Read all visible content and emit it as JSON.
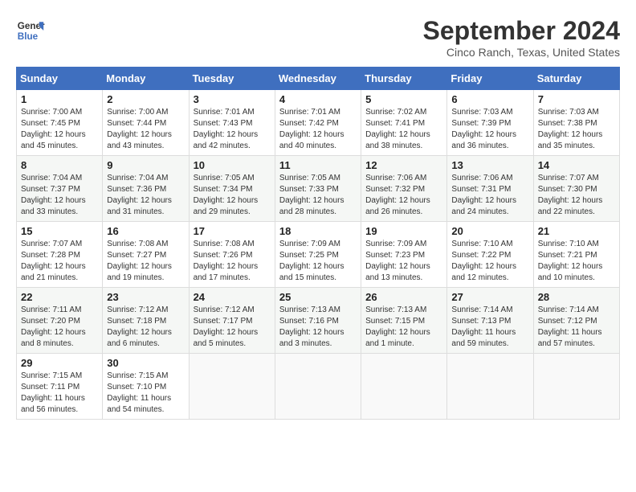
{
  "header": {
    "logo_line1": "General",
    "logo_line2": "Blue",
    "month_title": "September 2024",
    "location": "Cinco Ranch, Texas, United States"
  },
  "calendar": {
    "days_of_week": [
      "Sunday",
      "Monday",
      "Tuesday",
      "Wednesday",
      "Thursday",
      "Friday",
      "Saturday"
    ],
    "weeks": [
      [
        null,
        {
          "day": "2",
          "sunrise": "Sunrise: 7:00 AM",
          "sunset": "Sunset: 7:44 PM",
          "daylight": "Daylight: 12 hours and 43 minutes."
        },
        {
          "day": "3",
          "sunrise": "Sunrise: 7:01 AM",
          "sunset": "Sunset: 7:43 PM",
          "daylight": "Daylight: 12 hours and 42 minutes."
        },
        {
          "day": "4",
          "sunrise": "Sunrise: 7:01 AM",
          "sunset": "Sunset: 7:42 PM",
          "daylight": "Daylight: 12 hours and 40 minutes."
        },
        {
          "day": "5",
          "sunrise": "Sunrise: 7:02 AM",
          "sunset": "Sunset: 7:41 PM",
          "daylight": "Daylight: 12 hours and 38 minutes."
        },
        {
          "day": "6",
          "sunrise": "Sunrise: 7:03 AM",
          "sunset": "Sunset: 7:39 PM",
          "daylight": "Daylight: 12 hours and 36 minutes."
        },
        {
          "day": "7",
          "sunrise": "Sunrise: 7:03 AM",
          "sunset": "Sunset: 7:38 PM",
          "daylight": "Daylight: 12 hours and 35 minutes."
        }
      ],
      [
        {
          "day": "1",
          "sunrise": "Sunrise: 7:00 AM",
          "sunset": "Sunset: 7:45 PM",
          "daylight": "Daylight: 12 hours and 45 minutes."
        },
        {
          "day": "9",
          "sunrise": "Sunrise: 7:04 AM",
          "sunset": "Sunset: 7:36 PM",
          "daylight": "Daylight: 12 hours and 31 minutes."
        },
        {
          "day": "10",
          "sunrise": "Sunrise: 7:05 AM",
          "sunset": "Sunset: 7:34 PM",
          "daylight": "Daylight: 12 hours and 29 minutes."
        },
        {
          "day": "11",
          "sunrise": "Sunrise: 7:05 AM",
          "sunset": "Sunset: 7:33 PM",
          "daylight": "Daylight: 12 hours and 28 minutes."
        },
        {
          "day": "12",
          "sunrise": "Sunrise: 7:06 AM",
          "sunset": "Sunset: 7:32 PM",
          "daylight": "Daylight: 12 hours and 26 minutes."
        },
        {
          "day": "13",
          "sunrise": "Sunrise: 7:06 AM",
          "sunset": "Sunset: 7:31 PM",
          "daylight": "Daylight: 12 hours and 24 minutes."
        },
        {
          "day": "14",
          "sunrise": "Sunrise: 7:07 AM",
          "sunset": "Sunset: 7:30 PM",
          "daylight": "Daylight: 12 hours and 22 minutes."
        }
      ],
      [
        {
          "day": "8",
          "sunrise": "Sunrise: 7:04 AM",
          "sunset": "Sunset: 7:37 PM",
          "daylight": "Daylight: 12 hours and 33 minutes."
        },
        {
          "day": "16",
          "sunrise": "Sunrise: 7:08 AM",
          "sunset": "Sunset: 7:27 PM",
          "daylight": "Daylight: 12 hours and 19 minutes."
        },
        {
          "day": "17",
          "sunrise": "Sunrise: 7:08 AM",
          "sunset": "Sunset: 7:26 PM",
          "daylight": "Daylight: 12 hours and 17 minutes."
        },
        {
          "day": "18",
          "sunrise": "Sunrise: 7:09 AM",
          "sunset": "Sunset: 7:25 PM",
          "daylight": "Daylight: 12 hours and 15 minutes."
        },
        {
          "day": "19",
          "sunrise": "Sunrise: 7:09 AM",
          "sunset": "Sunset: 7:23 PM",
          "daylight": "Daylight: 12 hours and 13 minutes."
        },
        {
          "day": "20",
          "sunrise": "Sunrise: 7:10 AM",
          "sunset": "Sunset: 7:22 PM",
          "daylight": "Daylight: 12 hours and 12 minutes."
        },
        {
          "day": "21",
          "sunrise": "Sunrise: 7:10 AM",
          "sunset": "Sunset: 7:21 PM",
          "daylight": "Daylight: 12 hours and 10 minutes."
        }
      ],
      [
        {
          "day": "15",
          "sunrise": "Sunrise: 7:07 AM",
          "sunset": "Sunset: 7:28 PM",
          "daylight": "Daylight: 12 hours and 21 minutes."
        },
        {
          "day": "23",
          "sunrise": "Sunrise: 7:12 AM",
          "sunset": "Sunset: 7:18 PM",
          "daylight": "Daylight: 12 hours and 6 minutes."
        },
        {
          "day": "24",
          "sunrise": "Sunrise: 7:12 AM",
          "sunset": "Sunset: 7:17 PM",
          "daylight": "Daylight: 12 hours and 5 minutes."
        },
        {
          "day": "25",
          "sunrise": "Sunrise: 7:13 AM",
          "sunset": "Sunset: 7:16 PM",
          "daylight": "Daylight: 12 hours and 3 minutes."
        },
        {
          "day": "26",
          "sunrise": "Sunrise: 7:13 AM",
          "sunset": "Sunset: 7:15 PM",
          "daylight": "Daylight: 12 hours and 1 minute."
        },
        {
          "day": "27",
          "sunrise": "Sunrise: 7:14 AM",
          "sunset": "Sunset: 7:13 PM",
          "daylight": "Daylight: 11 hours and 59 minutes."
        },
        {
          "day": "28",
          "sunrise": "Sunrise: 7:14 AM",
          "sunset": "Sunset: 7:12 PM",
          "daylight": "Daylight: 11 hours and 57 minutes."
        }
      ],
      [
        {
          "day": "22",
          "sunrise": "Sunrise: 7:11 AM",
          "sunset": "Sunset: 7:20 PM",
          "daylight": "Daylight: 12 hours and 8 minutes."
        },
        {
          "day": "30",
          "sunrise": "Sunrise: 7:15 AM",
          "sunset": "Sunset: 7:10 PM",
          "daylight": "Daylight: 11 hours and 54 minutes."
        },
        null,
        null,
        null,
        null,
        null
      ],
      [
        {
          "day": "29",
          "sunrise": "Sunrise: 7:15 AM",
          "sunset": "Sunset: 7:11 PM",
          "daylight": "Daylight: 11 hours and 56 minutes."
        },
        null,
        null,
        null,
        null,
        null,
        null
      ]
    ]
  }
}
